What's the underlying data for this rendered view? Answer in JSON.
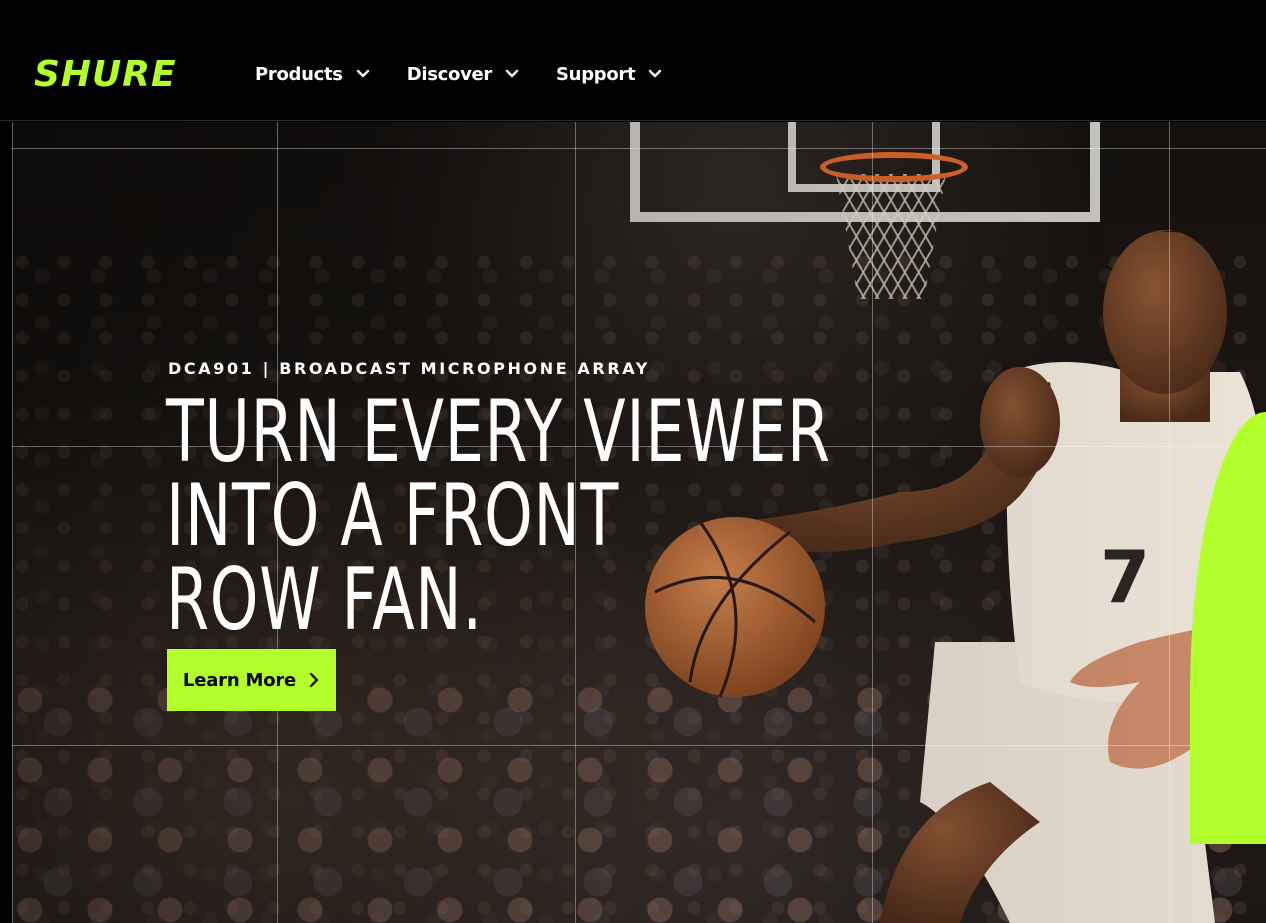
{
  "brand": {
    "logo_text": "SHURE",
    "accent_color": "#b3ff2b"
  },
  "nav": {
    "items": [
      {
        "label": "Products",
        "icon": "chevron-down-icon"
      },
      {
        "label": "Discover",
        "icon": "chevron-down-icon"
      },
      {
        "label": "Support",
        "icon": "chevron-down-icon"
      }
    ]
  },
  "hero": {
    "eyebrow": "DCA901 | BROADCAST MICROPHONE ARRAY",
    "headline_lines": [
      "TURN EVERY VIEWER",
      "INTO A FRONT",
      "ROW FAN."
    ],
    "cta": {
      "label": "Learn More",
      "icon": "chevron-right-icon"
    },
    "jersey_number": "7"
  }
}
